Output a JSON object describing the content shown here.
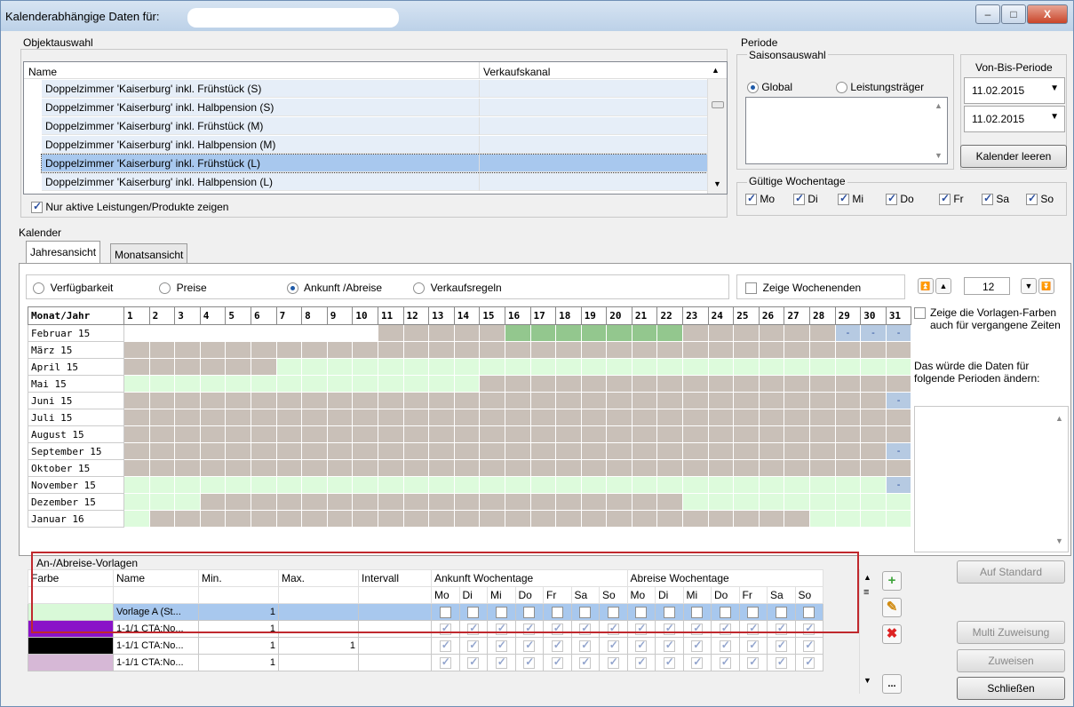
{
  "window": {
    "title": "Kalenderabhängige Daten für:",
    "minimize": "–",
    "maximize": "□",
    "close": "X"
  },
  "objektauswahl": {
    "group": "Objektauswahl",
    "col_name": "Name",
    "col_channel": "Verkaufskanal",
    "rows": [
      "Doppelzimmer 'Kaiserburg' inkl. Frühstück (S)",
      "Doppelzimmer 'Kaiserburg' inkl. Halbpension (S)",
      "Doppelzimmer 'Kaiserburg' inkl. Frühstück (M)",
      "Doppelzimmer 'Kaiserburg' inkl. Halbpension (M)",
      "Doppelzimmer 'Kaiserburg' inkl. Frühstück (L)",
      "Doppelzimmer 'Kaiserburg' inkl. Halbpension (L)"
    ],
    "active_only": "Nur aktive Leistungen/Produkte zeigen"
  },
  "periode": {
    "group": "Periode",
    "saison": "Saisonsauswahl",
    "global": "Global",
    "leistungstraeger": "Leistungsträger",
    "vonbis": "Von-Bis-Periode",
    "date1": "11.02.2015",
    "date2": "11.02.2015",
    "clear": "Kalender leeren",
    "wochentage": "Gültige Wochentage",
    "days": [
      "Mo",
      "Di",
      "Mi",
      "Do",
      "Fr",
      "Sa",
      "So"
    ]
  },
  "kalender": {
    "group": "Kalender",
    "tab1": "Jahresansicht",
    "tab2": "Monatsansicht",
    "modes": [
      "Verfügbarkeit",
      "Preise",
      "Ankunft /Abreise",
      "Verkaufsregeln"
    ],
    "weekends": "Zeige Wochenenden",
    "spin": "12",
    "header": "Monat/Jahr",
    "months": [
      "Februar 15",
      "März 15",
      "April 15",
      "Mai 15",
      "Juni 15",
      "Juli 15",
      "August 15",
      "September 15",
      "Oktober 15",
      "November 15",
      "Dezember 15",
      "Januar 16"
    ],
    "grid": [
      "wwwwwwwwwwgggggdddddddggggggbbb",
      "ggggggggggggggggggggggggggggggg",
      "gggggglllllllllllllllllllllllll",
      "llllllllllllllgggggggggggggggggg",
      "ggggggggggggggggggggggggggggggb",
      "ggggggggggggggggggggggggggggggg",
      "ggggggggggggggggggggggggggggggg",
      "ggggggggggggggggggggggggggggggb",
      "ggggggggggggggggggggggggggggggg",
      "llllllllllllllllllllllllllllllb",
      "lllgggggggggggggggggggllllllllll",
      "lgggggggggggggggggggggggggglllll"
    ],
    "dash": "-",
    "side_check": "Zeige die Vorlagen-Farben auch für vergangene Zeiten",
    "side_text": "Das würde die Daten für folgende Perioden ändern:"
  },
  "vorlagen": {
    "group": "An-/Abreise-Vorlagen",
    "cols": [
      "Farbe",
      "Name",
      "Min.",
      "Max.",
      "Intervall"
    ],
    "ankunft": "Ankunft Wochentage",
    "abreise": "Abreise Wochentage",
    "rows": [
      {
        "color": "#d9f9d8",
        "name": "Vorlage A (St...",
        "min": "1",
        "max": ""
      },
      {
        "color": "#8a12c8",
        "name": "1-1/1 CTA:No...",
        "min": "1",
        "max": ""
      },
      {
        "color": "#000000",
        "name": "1-1/1 CTA:No...",
        "min": "1",
        "max": "1"
      },
      {
        "color": "#d6b8d6",
        "name": "1-1/1 CTA:No...",
        "min": "1",
        "max": ""
      }
    ]
  },
  "buttons": {
    "auf_standard": "Auf Standard",
    "multi": "Multi Zuweisung",
    "zuweisen": "Zuweisen",
    "schliessen": "Schließen",
    "more": "..."
  }
}
